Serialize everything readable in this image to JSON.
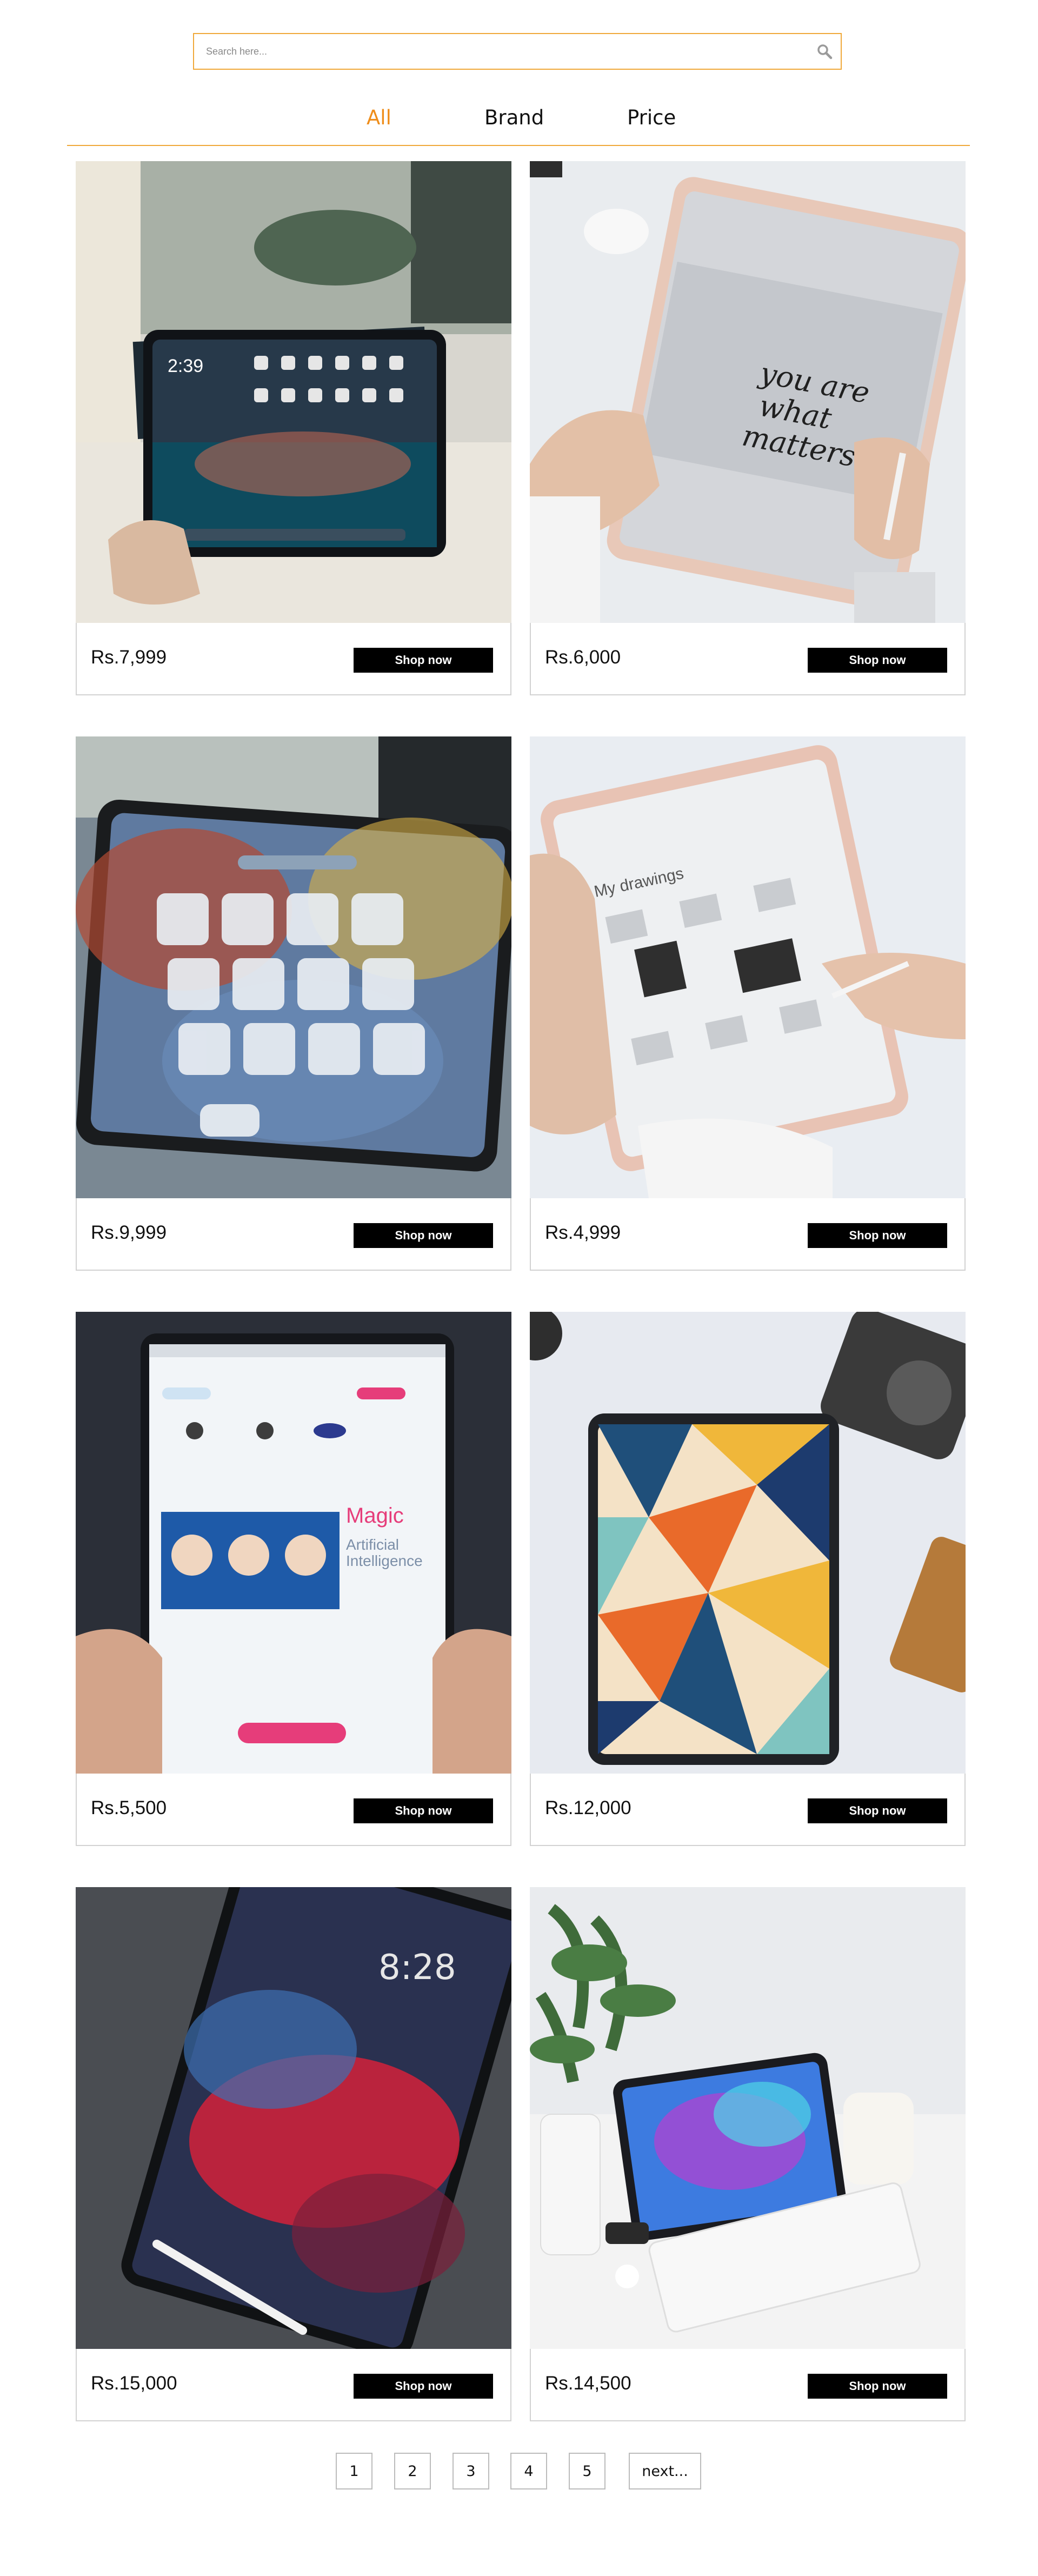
{
  "search": {
    "placeholder": "Search here...",
    "value": ""
  },
  "tabs": [
    {
      "label": "All",
      "active": true
    },
    {
      "label": "Brand",
      "active": false
    },
    {
      "label": "Price",
      "active": false
    }
  ],
  "products": [
    {
      "price": "Rs.7,999",
      "button": "Shop now"
    },
    {
      "price": "Rs.6,000",
      "button": "Shop now"
    },
    {
      "price": "Rs.9,999",
      "button": "Shop now"
    },
    {
      "price": "Rs.4,999",
      "button": "Shop now"
    },
    {
      "price": "Rs.5,500",
      "button": "Shop now"
    },
    {
      "price": "Rs.12,000",
      "button": "Shop now"
    },
    {
      "price": "Rs.15,000",
      "button": "Shop now"
    },
    {
      "price": "Rs.14,500",
      "button": "Shop now"
    }
  ],
  "pagination": {
    "pages": [
      "1",
      "2",
      "3",
      "4",
      "5"
    ],
    "next": "next..."
  },
  "colors": {
    "accent": "#ef8d1a",
    "border_accent": "#f0a93a",
    "button_bg": "#000000",
    "button_text": "#ffffff"
  },
  "icons": {
    "search": "search-icon"
  }
}
